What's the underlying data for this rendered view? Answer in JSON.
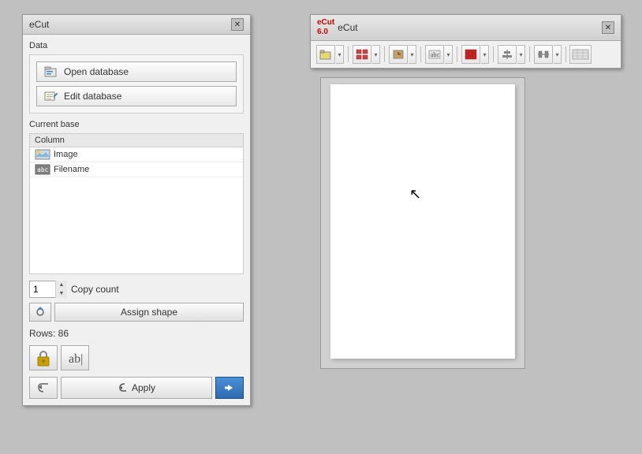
{
  "mainPanel": {
    "title": "eCut",
    "sections": {
      "data": {
        "label": "Data",
        "openDbBtn": "Open database",
        "editDbBtn": "Edit database"
      },
      "currentBase": {
        "label": "Current base",
        "columns": [
          {
            "name": "Column",
            "width": "auto"
          }
        ],
        "rows": [
          {
            "type": "image",
            "label": "Image"
          },
          {
            "type": "filename",
            "label": "Filename"
          }
        ]
      },
      "copyCount": {
        "value": "1",
        "label": "Copy count"
      },
      "assignShape": {
        "label": "Assign shape"
      },
      "rowsInfo": {
        "label": "Rows: 86"
      },
      "apply": {
        "label": "Apply"
      }
    }
  },
  "toolbarWindow": {
    "title": "eCut",
    "version": "6.0"
  },
  "icons": {
    "close": "✕",
    "arrowUp": "▲",
    "arrowDown": "▼",
    "arrowLeft": "◀",
    "arrowRight": "▶",
    "chevronDown": "▾",
    "checkMark": "✓",
    "back": "↩",
    "link": "🔗"
  }
}
